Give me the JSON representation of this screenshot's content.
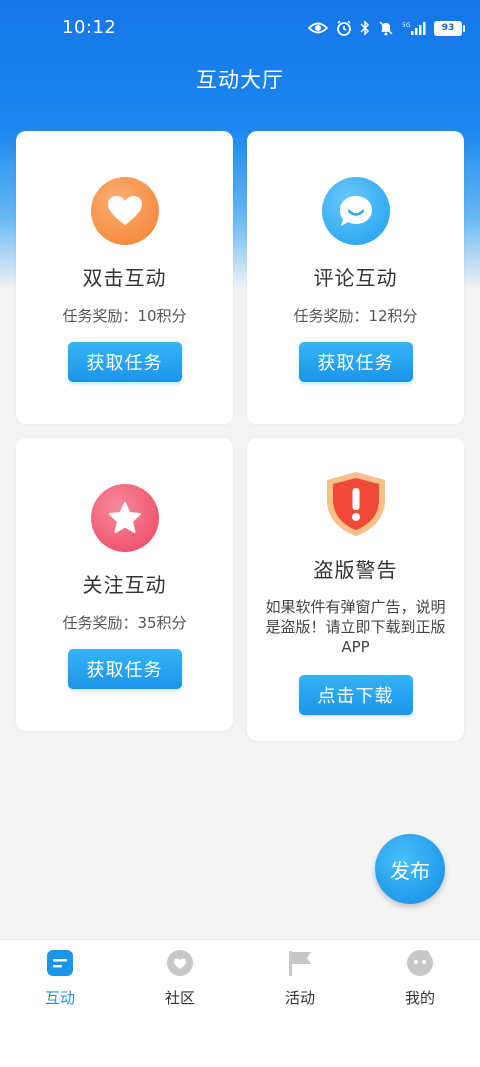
{
  "status_bar": {
    "time": "10:12",
    "battery": "93",
    "icons": [
      "eye-icon",
      "alarm-icon",
      "bluetooth-icon",
      "mute-icon",
      "signal-icon",
      "battery-icon"
    ]
  },
  "header": {
    "title": "互动大厅"
  },
  "cards": [
    {
      "title": "双击互动",
      "reward": "任务奖励：10积分",
      "button": "获取任务",
      "icon": "heart-icon",
      "color": "#f5893d"
    },
    {
      "title": "评论互动",
      "reward": "任务奖励：12积分",
      "button": "获取任务",
      "icon": "chat-bubble-icon",
      "color": "#2ba6f2"
    },
    {
      "title": "关注互动",
      "reward": "任务奖励：35积分",
      "button": "获取任务",
      "icon": "star-icon",
      "color": "#f0516b"
    },
    {
      "title": "盗版警告",
      "description": "如果软件有弹窗广告，说明是盗版！请立即下载到正版APP",
      "button": "点击下载",
      "icon": "warning-shield-icon",
      "color": "#f04a36"
    }
  ],
  "fab": {
    "label": "发布"
  },
  "tabbar": {
    "active": "互动",
    "tabs": [
      {
        "label": "互动",
        "icon": "interaction-icon"
      },
      {
        "label": "社区",
        "icon": "community-icon"
      },
      {
        "label": "活动",
        "icon": "flag-icon"
      },
      {
        "label": "我的",
        "icon": "profile-icon"
      }
    ]
  },
  "colors": {
    "primary": "#1b95e8",
    "header": "#1576e8",
    "background": "#f4f4f4"
  }
}
